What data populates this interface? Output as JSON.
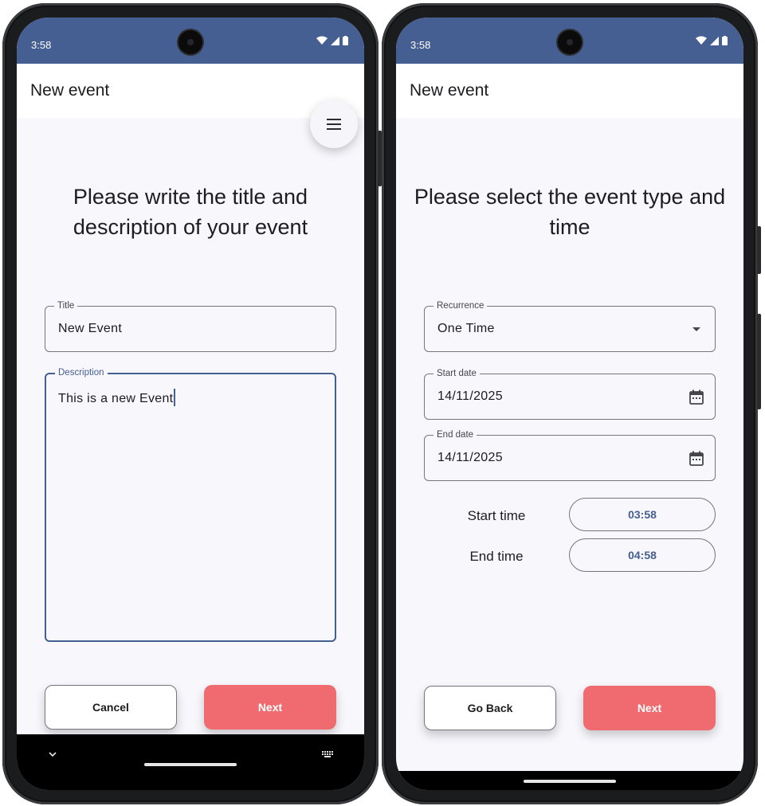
{
  "left_screen": {
    "status_time": "3:58",
    "app_title": "New event",
    "heading": "Please write the title and description of your event",
    "title_field": {
      "label": "Title",
      "value": "New Event"
    },
    "description_field": {
      "label": "Description",
      "value": "This is a new Event"
    },
    "cancel_label": "Cancel",
    "next_label": "Next",
    "menu_icon": "menu-icon"
  },
  "right_screen": {
    "status_time": "3:58",
    "app_title": "New event",
    "heading": "Please select the event type and time",
    "recurrence": {
      "label": "Recurrence",
      "value": "One Time"
    },
    "start_date": {
      "label": "Start date",
      "value": "14/11/2025"
    },
    "end_date": {
      "label": "End date",
      "value": "14/11/2025"
    },
    "start_time": {
      "label": "Start time",
      "value": "03:58"
    },
    "end_time": {
      "label": "End time",
      "value": "04:58"
    },
    "back_label": "Go Back",
    "next_label": "Next"
  },
  "colors": {
    "status_bar": "#465f92",
    "accent": "#465f92",
    "primary_button": "#ef6b70",
    "background": "#f7f7fc"
  }
}
